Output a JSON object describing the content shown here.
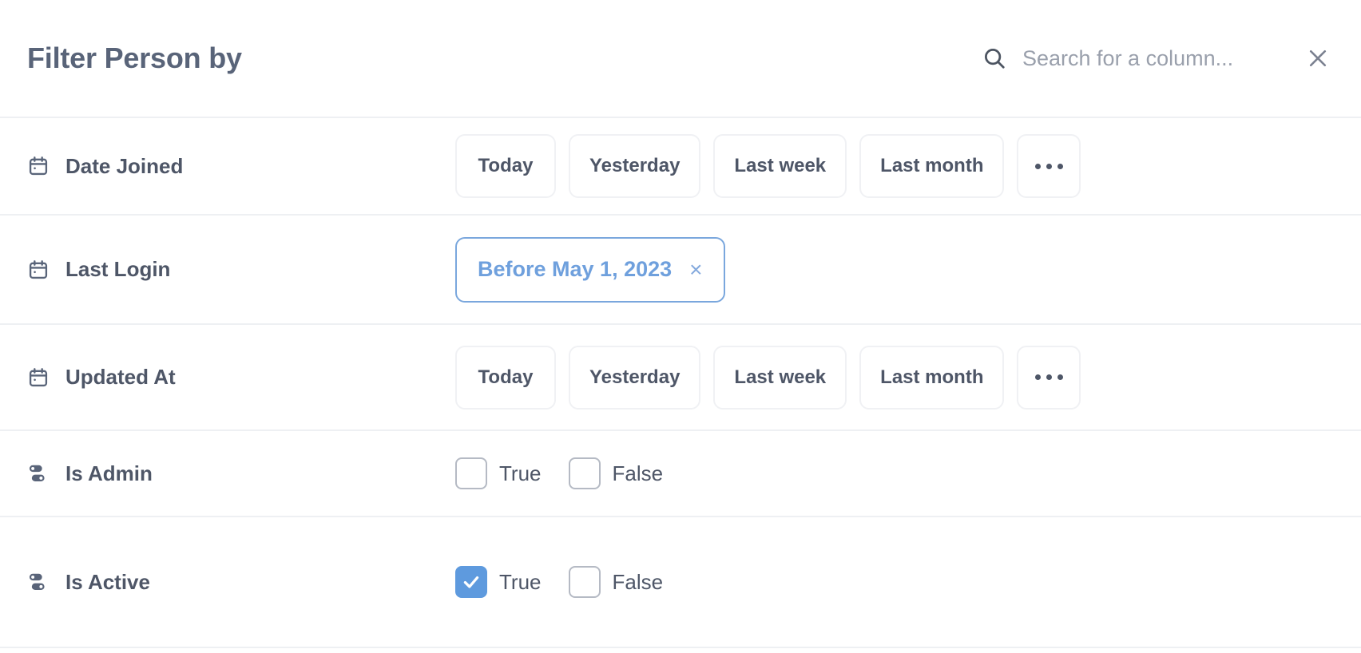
{
  "header": {
    "title": "Filter Person by",
    "search": {
      "icon": "search-icon",
      "value": "",
      "placeholder": "Search for a column..."
    },
    "close": {
      "icon": "close-icon",
      "label": "×"
    }
  },
  "colors": {
    "accent_blue": "#5e9ade",
    "chip_blue": "#6fa0dd",
    "text_slate": "#4e5667",
    "title_slate": "#596479",
    "border_gray": "#f0f1f4",
    "divider_gray": "#eef0f3",
    "placeholder_gray": "#9aa0ac",
    "checkbox_border": "#b5bac4"
  },
  "rows": [
    {
      "name": "Date Joined",
      "icon": "calendar-icon",
      "type": "date",
      "buttons": [
        {
          "label": "Today"
        },
        {
          "label": "Yesterday"
        },
        {
          "label": "Last week"
        },
        {
          "label": "Last month"
        },
        {
          "label": "…",
          "more": true
        }
      ]
    },
    {
      "name": "Last Login",
      "icon": "calendar-icon",
      "type": "chip",
      "chip": {
        "label": "Before May 1, 2023",
        "remove_label": "×",
        "active": true
      }
    },
    {
      "name": "Updated At",
      "icon": "calendar-icon",
      "type": "date",
      "buttons": [
        {
          "label": "Today"
        },
        {
          "label": "Yesterday"
        },
        {
          "label": "Last week"
        },
        {
          "label": "Last month"
        },
        {
          "label": "…",
          "more": true
        }
      ]
    },
    {
      "name": "Is Admin",
      "icon": "boolean-toggle-icon",
      "type": "boolean",
      "options": [
        {
          "label": "True",
          "checked": false
        },
        {
          "label": "False",
          "checked": false
        }
      ]
    },
    {
      "name": "Is Active",
      "icon": "boolean-toggle-icon",
      "type": "boolean",
      "options": [
        {
          "label": "True",
          "checked": true
        },
        {
          "label": "False",
          "checked": false
        }
      ]
    }
  ]
}
